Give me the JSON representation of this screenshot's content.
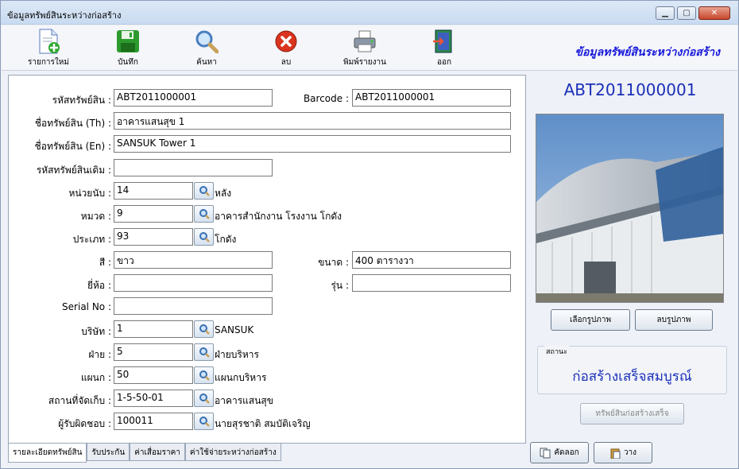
{
  "window": {
    "title": "ข้อมูลทรัพย์สินระหว่างก่อสร้าง"
  },
  "toolbar": {
    "new_label": "รายการใหม่",
    "save_label": "บันทึก",
    "search_label": "ค้นหา",
    "delete_label": "ลบ",
    "print_label": "พิมพ์รายงาน",
    "exit_label": "ออก",
    "headline": "ข้อมูลทรัพย์สินระหว่างก่อสร้าง"
  },
  "form": {
    "asset_code": {
      "label": "รหัสทรัพย์สิน :",
      "value": "ABT2011000001"
    },
    "barcode": {
      "label": "Barcode :",
      "value": "ABT2011000001"
    },
    "name_th": {
      "label": "ชื่อทรัพย์สิน (Th) :",
      "value": "อาคารแสนสุข 1"
    },
    "name_en": {
      "label": "ชื่อทรัพย์สิน (En) :",
      "value": "SANSUK Tower 1"
    },
    "old_code": {
      "label": "รหัสทรัพย์สินเดิม :",
      "value": ""
    },
    "unit": {
      "label": "หน่วยนับ :",
      "value": "14",
      "desc": "หลัง"
    },
    "category": {
      "label": "หมวด :",
      "value": "9",
      "desc": "อาคารสำนักงาน โรงงาน โกดัง"
    },
    "type": {
      "label": "ประเภท :",
      "value": "93",
      "desc": "โกดัง"
    },
    "color": {
      "label": "สี :",
      "value": "ขาว"
    },
    "size": {
      "label": "ขนาด :",
      "value": "400 ตารางวา"
    },
    "brand": {
      "label": "ยี่ห้อ :",
      "value": ""
    },
    "model": {
      "label": "รุ่น :",
      "value": ""
    },
    "serial": {
      "label": "Serial No :",
      "value": ""
    },
    "company": {
      "label": "บริษัท :",
      "value": "1",
      "desc": "SANSUK"
    },
    "division": {
      "label": "ฝ่าย :",
      "value": "5",
      "desc": "ฝ่ายบริหาร"
    },
    "department": {
      "label": "แผนก :",
      "value": "50",
      "desc": "แผนกบริหาร"
    },
    "location": {
      "label": "สถานที่จัดเก็บ :",
      "value": "1-5-50-01",
      "desc": "อาคารแสนสุข"
    },
    "custodian": {
      "label": "ผู้รับผิดชอบ :",
      "value": "100011",
      "desc": "นายสุรชาติ สมบัติเจริญ"
    }
  },
  "tabs": [
    "รายละเอียดทรัพย์สิน",
    "รับประกัน",
    "ค่าเสื่อมราคา",
    "ค่าใช้จ่ายระหว่างก่อสร้าง"
  ],
  "side": {
    "code": "ABT2011000001",
    "choose_image": "เลือกรูปภาพ",
    "delete_image": "ลบรูปภาพ",
    "status_caption": "สถานะ",
    "status_value": "ก่อสร้างเสร็จสมบูรณ์",
    "complete_button": "ทรัพย์สินก่อสร้างเสร็จ",
    "copy_button": "คัดลอก",
    "paste_button": "วาง"
  },
  "icons": [
    "new-doc-icon",
    "save-disk-icon",
    "search-magnifier-icon",
    "delete-x-icon",
    "printer-icon",
    "exit-door-icon",
    "search-icon",
    "copy-icon",
    "paste-icon"
  ]
}
